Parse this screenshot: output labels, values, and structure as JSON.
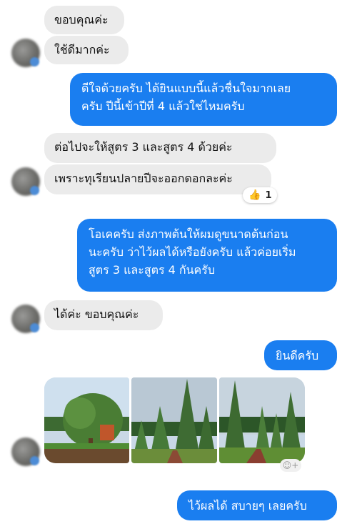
{
  "conversation": {
    "messages": [
      {
        "sender": "contact",
        "text": "ขอบคุณค่ะ"
      },
      {
        "sender": "contact",
        "text": "ใช้ดีมากค่ะ"
      },
      {
        "sender": "me",
        "text": "ดีใจด้วยครับ ได้ยินแบบนี้แล้วชื่นใจมากเลย\nครับ ปีนี้เข้าปีที่ 4 แล้วใช่ไหมครับ"
      },
      {
        "sender": "contact",
        "text": "ต่อไปจะให้สูตร 3  และสูตร  4 ด้วยค่ะ"
      },
      {
        "sender": "contact",
        "text": "เพราะทุเรียนปลายปีจะออกดอกละค่ะ"
      },
      {
        "sender": "me",
        "text": "โอเคครับ ส่งภาพต้นให้ผมดูขนาดต้นก่อน\nนะครับ ว่าไว้ผลได้หรือยังครับ แล้วค่อยเริ่ม\nสูตร 3 และสูตร 4 กันครับ"
      },
      {
        "sender": "contact",
        "text": "ได้ค่ะ  ขอบคุณค่ะ"
      },
      {
        "sender": "me",
        "text": "ยินดีครับ"
      },
      {
        "sender": "me",
        "text": "ไว้ผลได้ สบายๆ เลยครับ"
      }
    ],
    "reaction": {
      "icon": "thumbs-up-icon",
      "count": "1"
    },
    "photos": [
      {
        "name": "durian-tree-photo"
      },
      {
        "name": "orchard-row-photo"
      },
      {
        "name": "orchard-path-photo"
      }
    ],
    "add_reaction_icon": "add-reaction-icon"
  },
  "colors": {
    "outgoing_bubble": "#1a7ef0",
    "incoming_bubble": "#ebebeb"
  }
}
